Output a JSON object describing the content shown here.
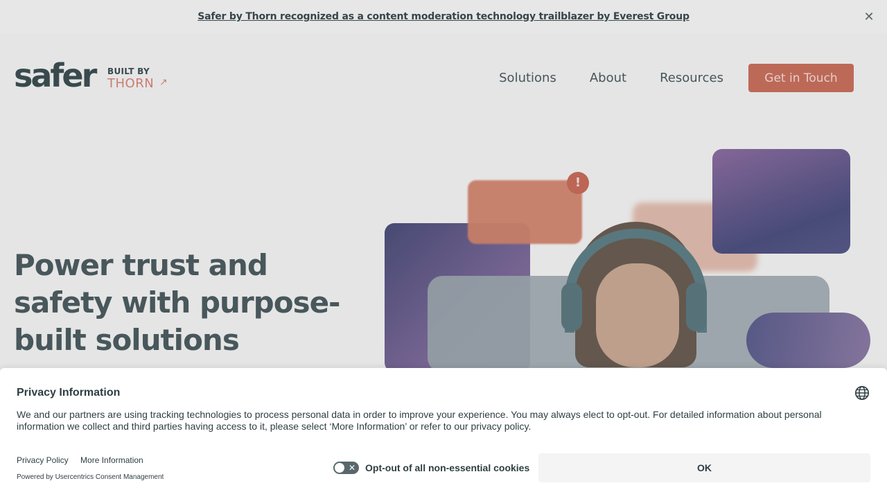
{
  "announcement": {
    "text": "Safer by Thorn recognized as a content moderation technology trailblazer by Everest Group",
    "close_glyph": "✕"
  },
  "logo": {
    "wordmark": "safer",
    "built_by": "BUILT BY",
    "thorn": "THORN"
  },
  "nav": {
    "items": [
      "Solutions",
      "About",
      "Resources"
    ],
    "cta": "Get in Touch"
  },
  "hero": {
    "title": "Power trust and safety with purpose-built solutions",
    "alert_glyph": "!"
  },
  "consent": {
    "title": "Privacy Information",
    "body": "We and our partners are using tracking technologies to process personal data in order to improve your experience. You may always elect to opt-out. For detailed information about personal information we collect and third parties having access to it, please select ‘More Information’ or refer to our privacy policy.",
    "privacy_policy": "Privacy Policy",
    "more_information": "More Information",
    "powered_by": "Powered by Usercentrics Consent Management",
    "opt_out_label": "Opt-out of all non-essential cookies",
    "ok": "OK"
  },
  "colors": {
    "brand_coral": "#c9705e",
    "text_dark": "#2e3e42"
  }
}
